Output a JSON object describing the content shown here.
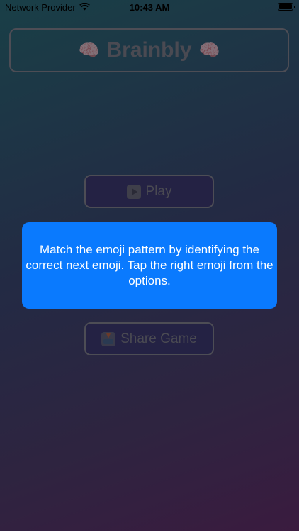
{
  "status_bar": {
    "carrier": "Network Provider",
    "time": "10:43 AM",
    "wifi_icon": "wifi-icon",
    "battery_icon": "battery-icon",
    "battery_level": 1.0
  },
  "header": {
    "title": "Brainbly",
    "left_emoji": "🧠",
    "right_emoji": "🧠"
  },
  "buttons": {
    "play_label": "Play",
    "play_icon": "play-button-icon",
    "share_label": "Share Game",
    "share_icon": "inbox-tray-icon"
  },
  "tooltip": {
    "message": "Match the emoji pattern by identifying the correct next emoji. Tap the right emoji from the options."
  },
  "colors": {
    "tooltip_background": "#0A7AFE",
    "background_top": "#193F47",
    "background_bottom": "#3A1B3F"
  }
}
